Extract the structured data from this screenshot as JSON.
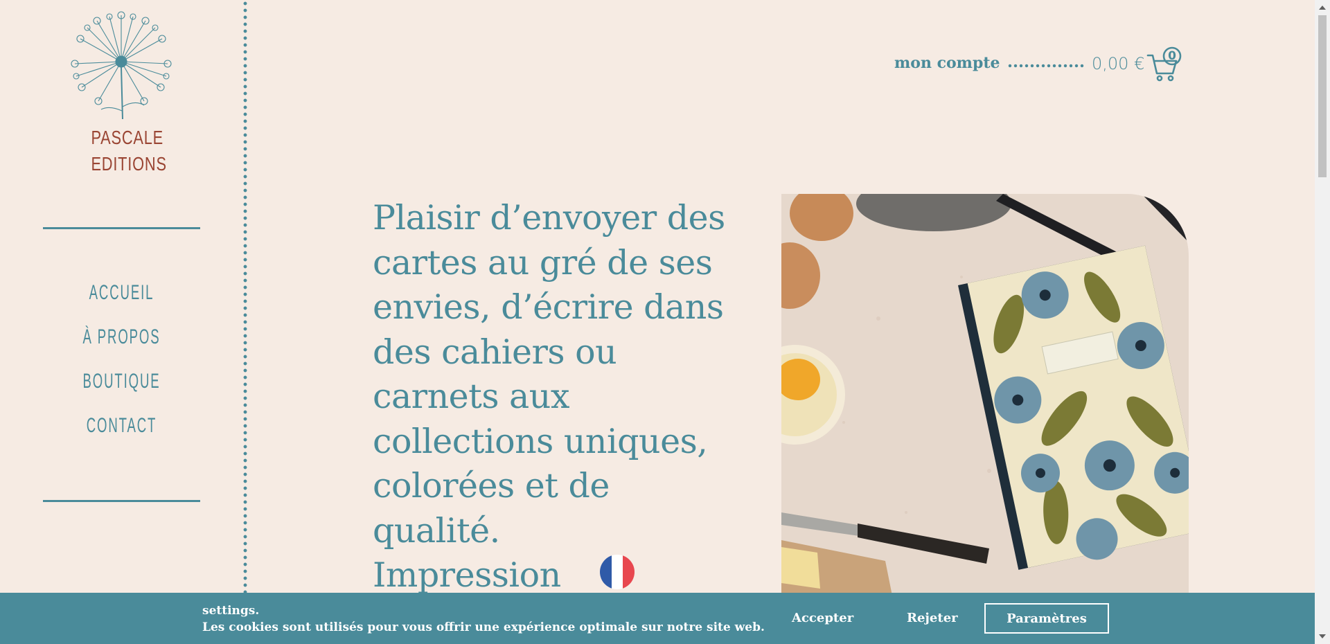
{
  "brand": {
    "line1": "PASCALE",
    "line2": "EDITIONS"
  },
  "nav": {
    "items": [
      {
        "label": "Accueil"
      },
      {
        "label": "À propos"
      },
      {
        "label": "Boutique"
      },
      {
        "label": "Contact"
      }
    ]
  },
  "header": {
    "account_label": "mon compte",
    "cart_total": "0,00 €",
    "cart_count": "0"
  },
  "hero": {
    "lines": [
      "Plaisir d’envoyer des",
      "cartes au gré de ses",
      "envies, d’écrire dans",
      "des cahiers ou",
      "carnets aux",
      "collections uniques,",
      "colorées et de",
      "qualité.",
      "Impression"
    ]
  },
  "cookie": {
    "line1": "settings.",
    "line2": "Les cookies sont utilisés pour vous offrir une expérience optimale sur notre site web.",
    "accept_label": "Accepter",
    "reject_label": "Rejeter",
    "settings_label": "Paramètres"
  },
  "colors": {
    "accent": "#4a8b9a",
    "background": "#f6ebe3",
    "brand": "#9a4533"
  },
  "icons": {
    "logo": "dandelion-logo",
    "cart": "cart-icon",
    "flag": "french-flag-icon"
  }
}
